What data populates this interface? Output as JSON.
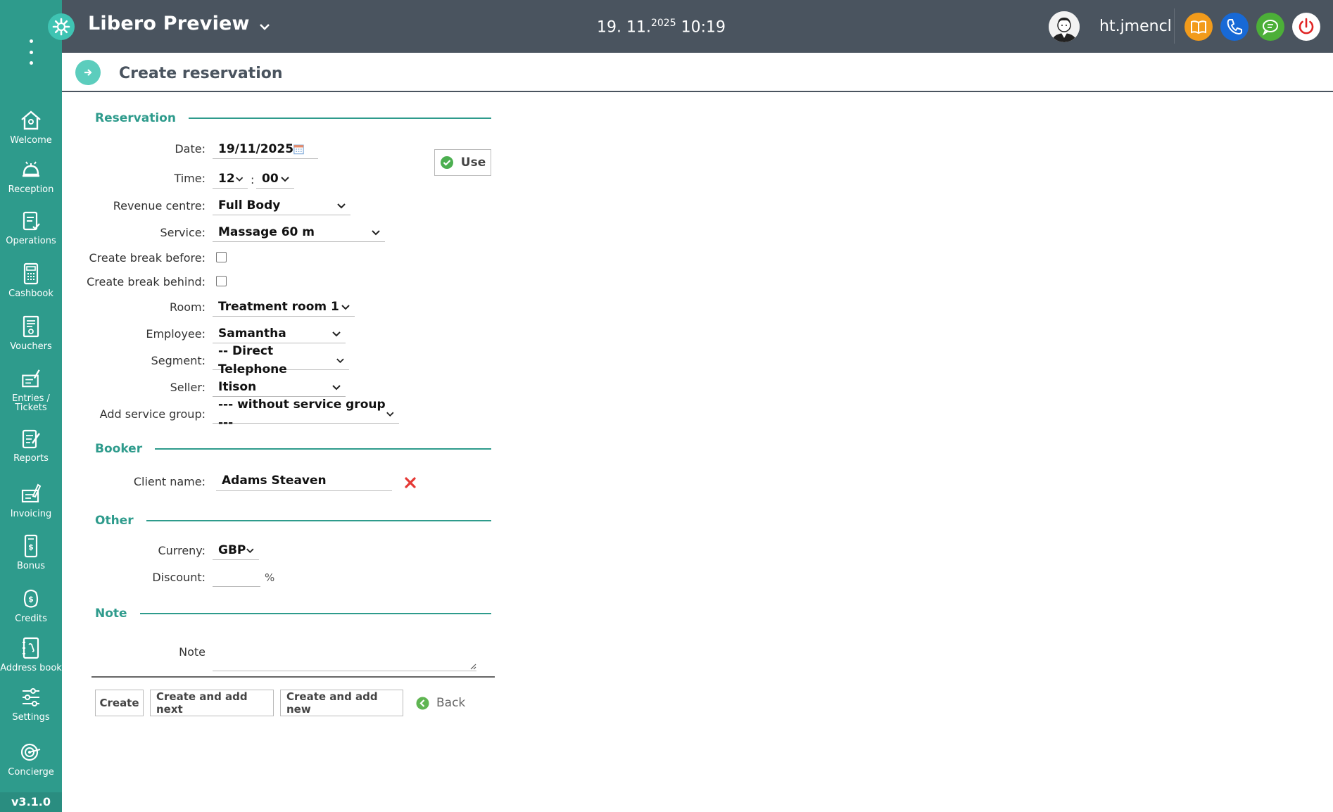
{
  "topbar": {
    "title": "Libero Preview",
    "date_main": "19. 11.",
    "date_year": "2025",
    "time": "10:19",
    "username": "ht.jmencl"
  },
  "sidebar": {
    "version": "v3.1.0",
    "items": [
      {
        "label": "Welcome",
        "icon": "home-icon"
      },
      {
        "label": "Reception",
        "icon": "bell-icon"
      },
      {
        "label": "Operations",
        "icon": "clipboard-icon"
      },
      {
        "label": "Cashbook",
        "icon": "calculator-icon"
      },
      {
        "label": "Vouchers",
        "icon": "voucher-icon"
      },
      {
        "label": "Entries /\nTickets",
        "icon": "tickets-icon"
      },
      {
        "label": "Reports",
        "icon": "reports-icon"
      },
      {
        "label": "Invoicing",
        "icon": "invoicing-icon"
      },
      {
        "label": "Bonus",
        "icon": "bonus-icon"
      },
      {
        "label": "Credits",
        "icon": "credits-icon"
      },
      {
        "label": "Address book",
        "icon": "address-book-icon"
      },
      {
        "label": "Settings",
        "icon": "sliders-icon"
      },
      {
        "label": "Concierge",
        "icon": "concierge-icon"
      }
    ]
  },
  "page": {
    "title": "Create reservation"
  },
  "reservation": {
    "section_title": "Reservation",
    "date_label": "Date:",
    "date_value": "19/11/2025",
    "time_label": "Time:",
    "time_hour": "12",
    "time_sep": ":",
    "time_minute": "00",
    "use_label": "Use",
    "revenue_label": "Revenue centre:",
    "revenue_value": "Full Body",
    "service_label": "Service:",
    "service_value": "Massage 60 m",
    "break_before_label": "Create break before:",
    "break_behind_label": "Create break behind:",
    "room_label": "Room:",
    "room_value": "Treatment room 1",
    "employee_label": "Employee:",
    "employee_value": "Samantha",
    "segment_label": "Segment:",
    "segment_value": "-- Direct Telephone",
    "seller_label": "Seller:",
    "seller_value": "Itison",
    "service_group_label": "Add service group:",
    "service_group_value": "--- without service group ---"
  },
  "booker": {
    "section_title": "Booker",
    "client_label": "Client name:",
    "client_value": "Adams Steaven"
  },
  "other": {
    "section_title": "Other",
    "currency_label": "Curreny:",
    "currency_value": "GBP",
    "discount_label": "Discount:",
    "discount_value": "",
    "discount_unit": "%"
  },
  "note": {
    "section_title": "Note",
    "note_label": "Note",
    "note_value": ""
  },
  "actions": {
    "create": "Create",
    "create_next": "Create and add next",
    "create_new": "Create and add new",
    "back": "Back"
  },
  "colors": {
    "sidebar": "#2e9b8c",
    "topbar": "#4a545f",
    "accent": "#2e9b8c",
    "book_button": "#f29b1b",
    "phone_button": "#1769d6",
    "chat_button": "#4caf38",
    "power_button": "#ffffff"
  }
}
